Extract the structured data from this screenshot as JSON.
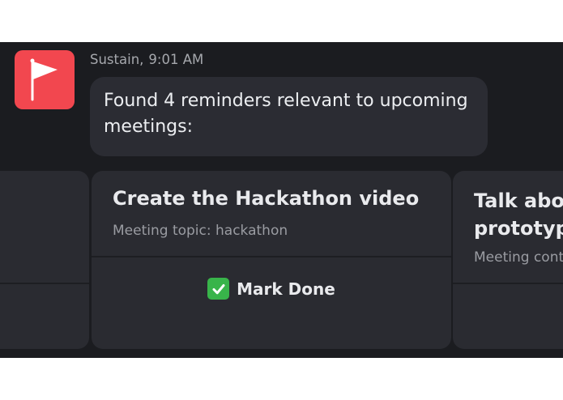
{
  "message": {
    "sender": "Sustain",
    "time": "9:01 AM",
    "text": "Found 4 reminders relevant to upcoming meetings:"
  },
  "cards": [
    {
      "title": "Create the Hackathon video",
      "subtitle": "Meeting topic: hackathon",
      "action_label": "Mark Done",
      "action_icon": "white-check-mark-icon"
    },
    {
      "title": "Talk about prototype",
      "subtitle": "Meeting cont"
    }
  ],
  "colors": {
    "avatar": "#f2474f",
    "chat_background": "#1b1c20",
    "bubble": "#2b2c33",
    "card": "#2a2b31",
    "check": "#38b44a"
  },
  "icons": {
    "avatar": "flag-icon",
    "action": "check-mark-icon"
  }
}
